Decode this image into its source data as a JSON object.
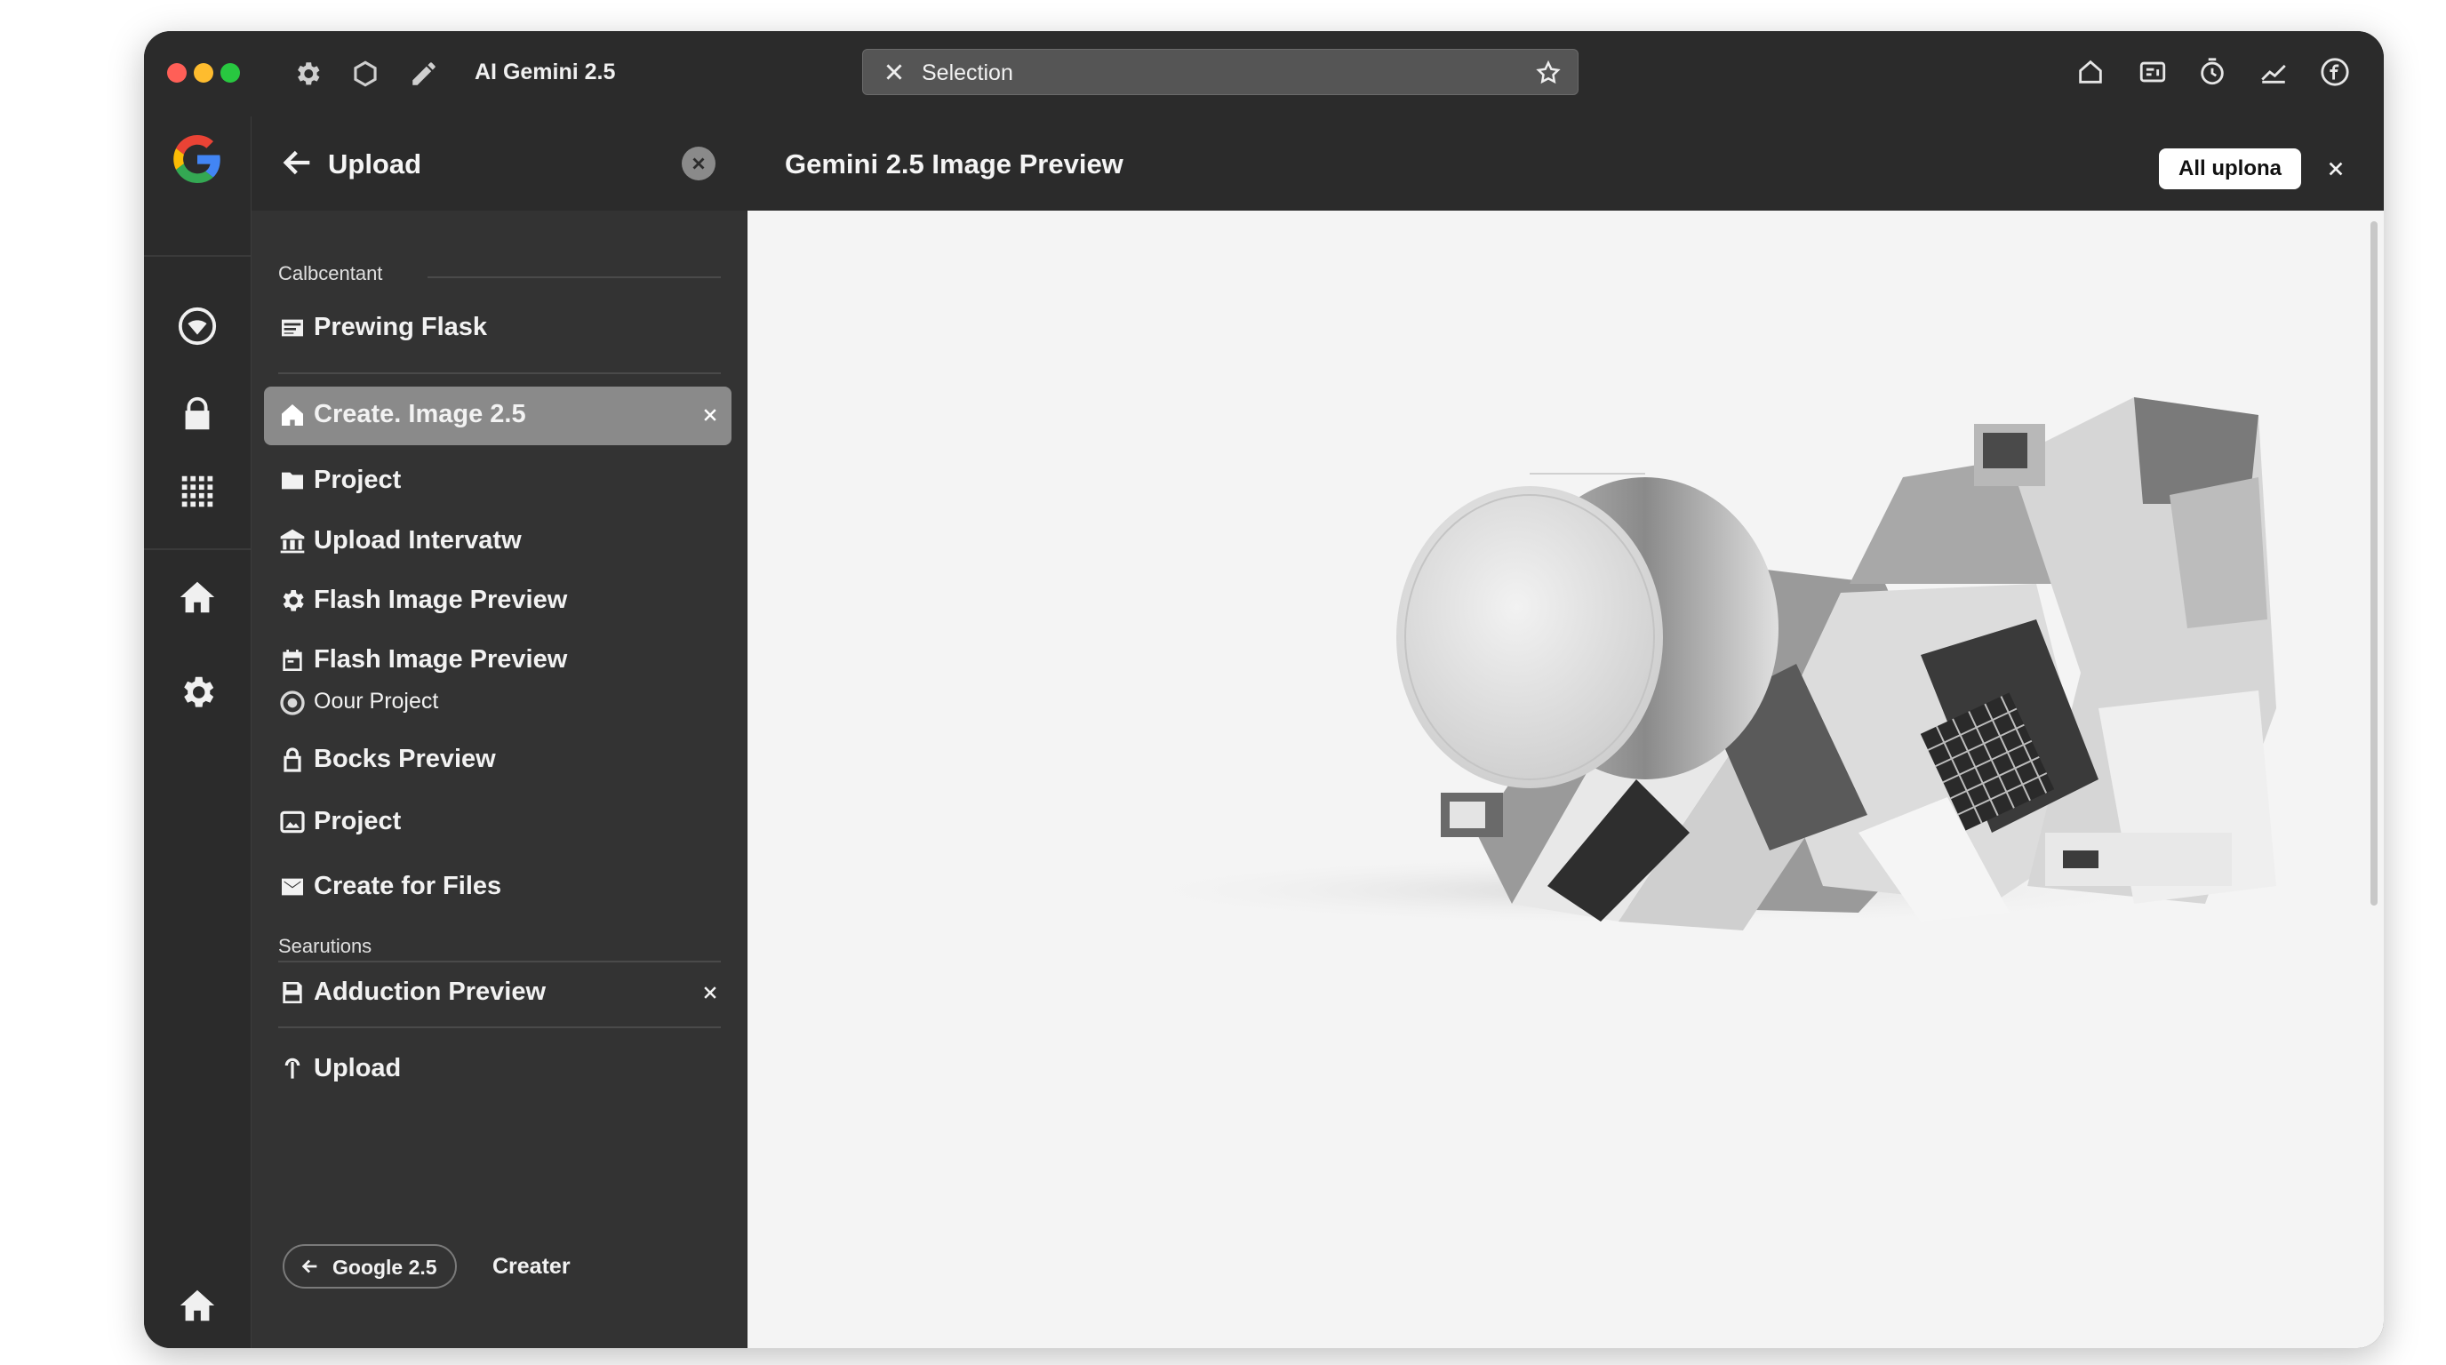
{
  "titlebar": {
    "app_title": "AI Gemini 2.5",
    "url_text": "Selection",
    "traffic_colors": [
      "#ff5f57",
      "#febc2e",
      "#28c840"
    ],
    "left_icons": [
      "gear-icon",
      "hexagon-icon",
      "pen-icon"
    ],
    "right_icons": [
      "home-outline-icon",
      "reader-icon",
      "timer-icon",
      "chart-icon",
      "facebook-icon"
    ]
  },
  "rail": {
    "icons": [
      "google-logo",
      "wifi-circle-icon",
      "lock-icon",
      "grid-icon",
      "home-icon",
      "settings-icon",
      "home-icon"
    ]
  },
  "sidebar": {
    "title": "Upload",
    "section1": "Calbcentant",
    "pinned_item": "Prewing Flask",
    "items": [
      {
        "label": "Create. Image 2.5",
        "icon": "home-icon",
        "active": true,
        "closable": true
      },
      {
        "label": "Project",
        "icon": "folder-icon"
      },
      {
        "label": "Upload Intervatw",
        "icon": "institution-icon"
      },
      {
        "label": "Flash Image Preview",
        "icon": "gear-icon"
      },
      {
        "label": "Flash Image Preview",
        "icon": "calendar-icon"
      },
      {
        "label": "Oour Project",
        "icon": "circle-icon",
        "sub": true
      },
      {
        "label": "Bocks Preview",
        "icon": "lock-icon"
      },
      {
        "label": "Project",
        "icon": "image-icon"
      },
      {
        "label": "Create for Files",
        "icon": "mail-icon"
      }
    ],
    "section2": "Searutions",
    "section2_items": [
      {
        "label": "Adduction Preview",
        "icon": "save-icon",
        "closable": true
      }
    ],
    "upload_item": "Upload",
    "footer": {
      "pill_label": "Google 2.5",
      "text": "Creater"
    }
  },
  "main": {
    "title": "Gemini 2.5 Image Preview",
    "button_label": "All uplona",
    "preview_image": "abstract-monochrome-sculpture"
  }
}
